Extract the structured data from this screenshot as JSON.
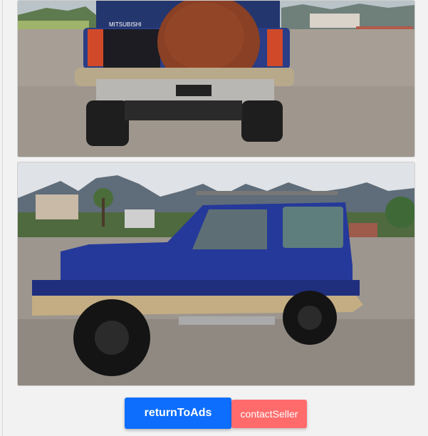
{
  "gallery": {
    "images": [
      {
        "name": "suv-rear-view",
        "badge_text": "MITSUBISHI"
      },
      {
        "name": "suv-side-view"
      }
    ]
  },
  "actions": {
    "return_label": "returnToAds",
    "contact_label": "contactSeller"
  },
  "colors": {
    "return_button": "#0d6efd",
    "contact_button": "#ff6b6b",
    "vehicle_body": "#25399a",
    "vehicle_trim": "#c4ad83"
  }
}
